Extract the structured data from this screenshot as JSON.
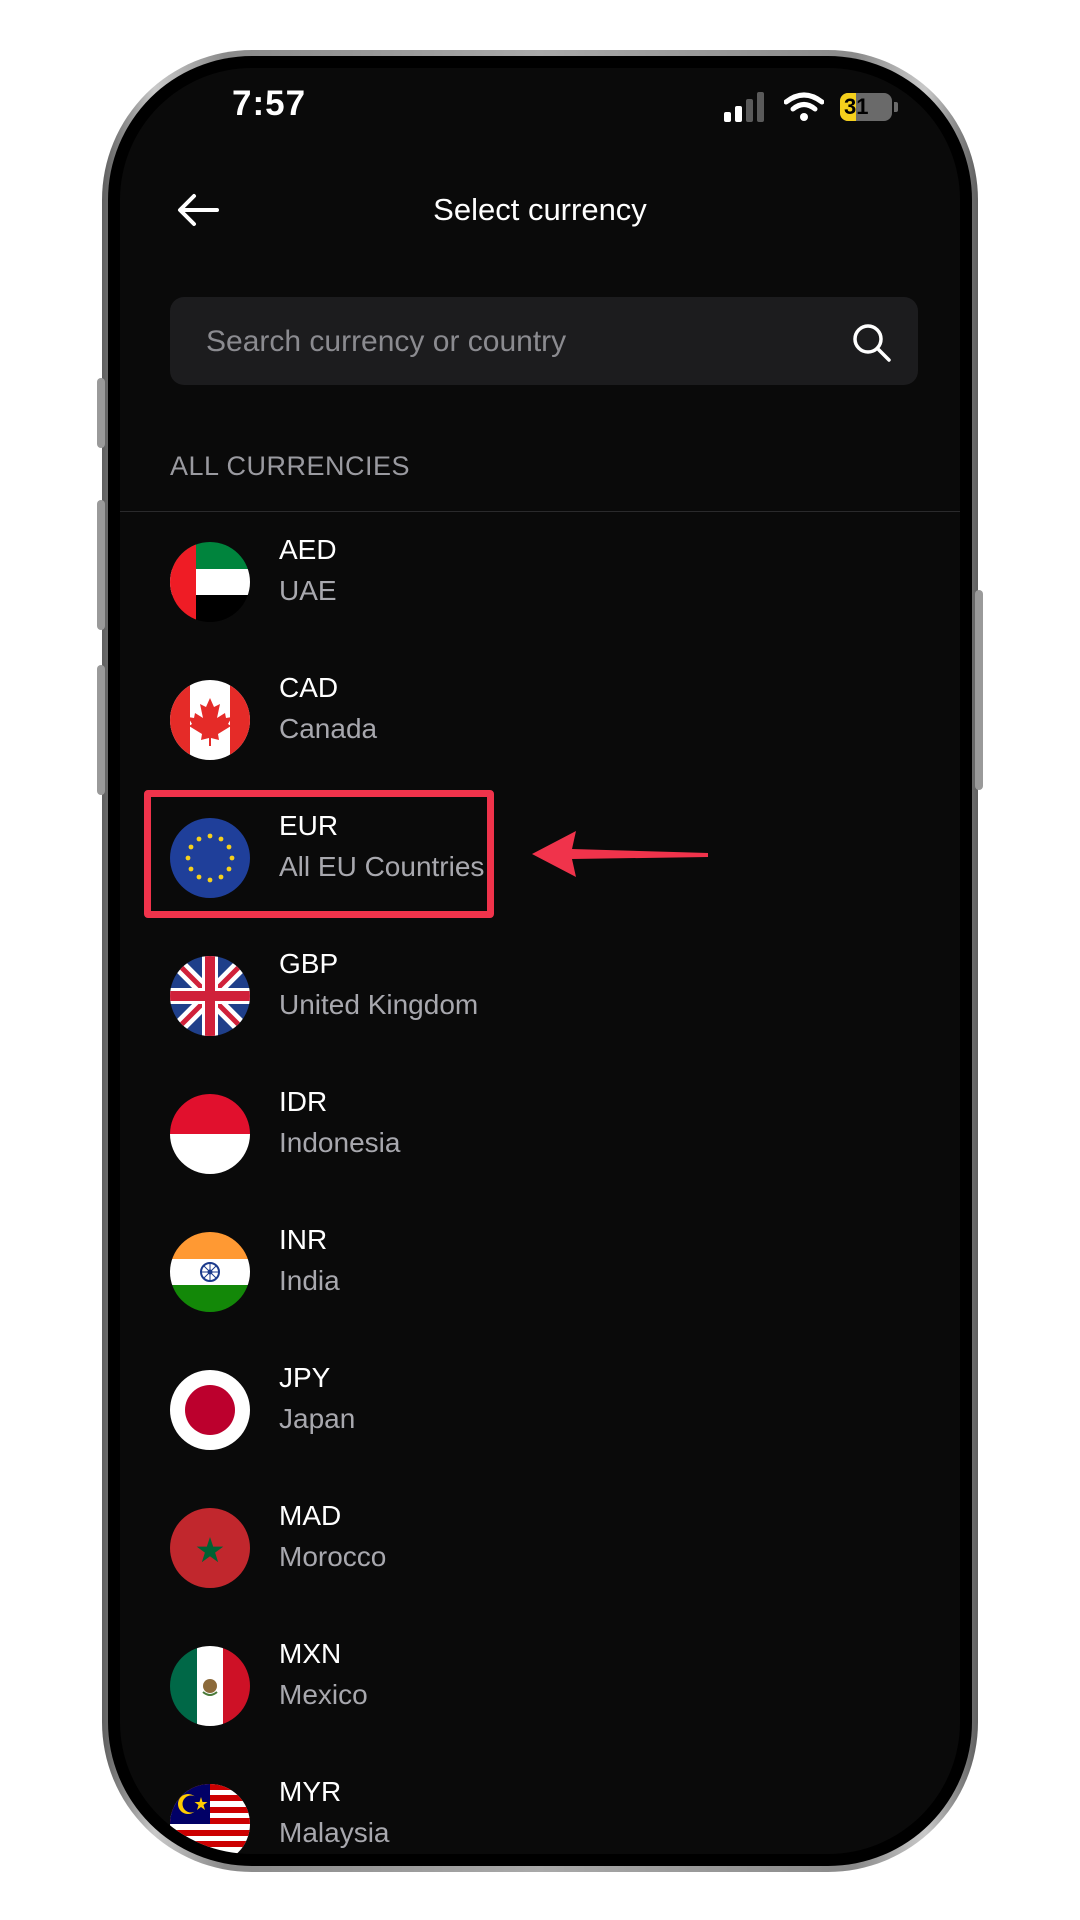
{
  "status_bar": {
    "time": "7:57",
    "battery": "31"
  },
  "header": {
    "title": "Select currency"
  },
  "search": {
    "placeholder": "Search currency or country"
  },
  "section": {
    "label": "ALL CURRENCIES"
  },
  "currencies": [
    {
      "code": "AED",
      "country": "UAE"
    },
    {
      "code": "CAD",
      "country": "Canada"
    },
    {
      "code": "EUR",
      "country": "All EU Countries"
    },
    {
      "code": "GBP",
      "country": "United Kingdom"
    },
    {
      "code": "IDR",
      "country": "Indonesia"
    },
    {
      "code": "INR",
      "country": "India"
    },
    {
      "code": "JPY",
      "country": "Japan"
    },
    {
      "code": "MAD",
      "country": "Morocco"
    },
    {
      "code": "MXN",
      "country": "Mexico"
    },
    {
      "code": "MYR",
      "country": "Malaysia"
    }
  ],
  "icons": {
    "back": "arrow-left-icon",
    "search": "search-icon",
    "signal": "cellular-signal-icon",
    "wifi": "wifi-icon",
    "battery": "battery-icon"
  },
  "colors": {
    "background": "#0a0a0a",
    "search_bg": "#1c1c1e",
    "highlight": "#f0334b",
    "secondary_text": "#a8a8ae"
  }
}
